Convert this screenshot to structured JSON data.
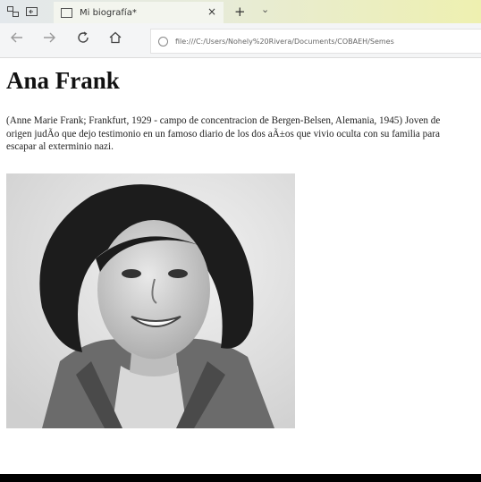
{
  "browser": {
    "tab_title": "Mi biografía*",
    "tab_close": "×",
    "new_tab": "+",
    "tab_menu": "⌄",
    "address": "file:///C:/Users/Nohely%20Rivera/Documents/COBAEH/Semes"
  },
  "page": {
    "title": "Ana Frank",
    "bio": "(Anne Marie Frank; Frankfurt, 1929 - campo de concentracion de Bergen-Belsen, Alemania, 1945) Joven de origen judÃo que dejo testimonio en un famoso diario de los dos aÃ±os que vivio oculta con su familia para escapar al exterminio nazi."
  },
  "icons": {
    "back": "arrow-left-icon",
    "forward": "arrow-right-icon",
    "refresh": "refresh-icon",
    "home": "home-icon",
    "info": "info-icon"
  },
  "colors": {
    "tabbar_start": "#e3e8ec",
    "tabbar_end": "#eef0b0",
    "text": "#222222"
  }
}
